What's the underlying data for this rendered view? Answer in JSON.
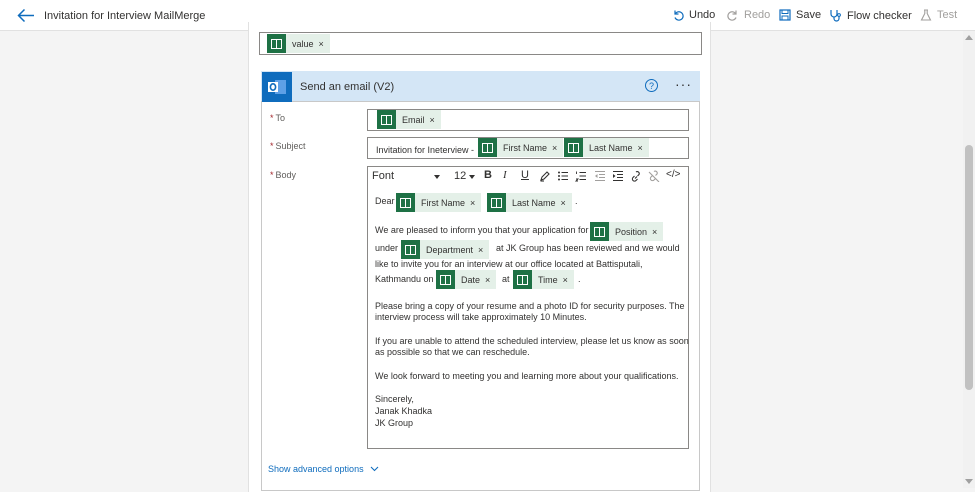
{
  "header": {
    "title": "Invitation for Interview MailMerge",
    "undo": "Undo",
    "redo": "Redo",
    "save": "Save",
    "flow_checker": "Flow checker",
    "test": "Test"
  },
  "previous": {
    "token": "value"
  },
  "action": {
    "title": "Send an email (V2)",
    "help": "?",
    "more": "···"
  },
  "fields": {
    "to_label": "To",
    "to_token": "Email",
    "subject_label": "Subject",
    "subject_prefix": "Invitation for Ineterview -",
    "subject_tokens": [
      "First Name",
      "Last Name"
    ],
    "body_label": "Body"
  },
  "toolbar": {
    "font": "Font",
    "size": "12",
    "bold": "B",
    "italic": "I",
    "underline": "U",
    "code": "</>"
  },
  "body": {
    "dear": "Dear",
    "dear_tokens": [
      "First Name",
      "Last Name"
    ],
    "dot": ".",
    "p1_a": "We are pleased to inform you that your application for",
    "position": "Position",
    "under": "under",
    "department": "Department",
    "p1_b": "at JK Group has been reviewed and we would",
    "p1_c": "like to invite you for an interview at our office located at Battisputali,",
    "p1_d": "Kathmandu on",
    "date": "Date",
    "at": "at",
    "time": "Time",
    "p2_a": "Please bring a copy of your resume and a photo ID for security purposes. The",
    "p2_b": "interview process will take approximately 10 Minutes.",
    "p3_a": "If you are unable to attend the scheduled interview, please let us know as soon",
    "p3_b": "as possible so that we can reschedule.",
    "p4": "We look forward to meeting you and learning more about your qualifications.",
    "s1": "Sincerely,",
    "s2": "Janak Khadka",
    "s3": "JK Group"
  },
  "advanced": "Show advanced options",
  "token_close": "×",
  "required_mark": "*",
  "colors": {
    "accent": "#0f6cbd",
    "excel_green": "#1e7145",
    "token_bg": "#e4f0e8",
    "card_header": "#d4e6f6"
  }
}
